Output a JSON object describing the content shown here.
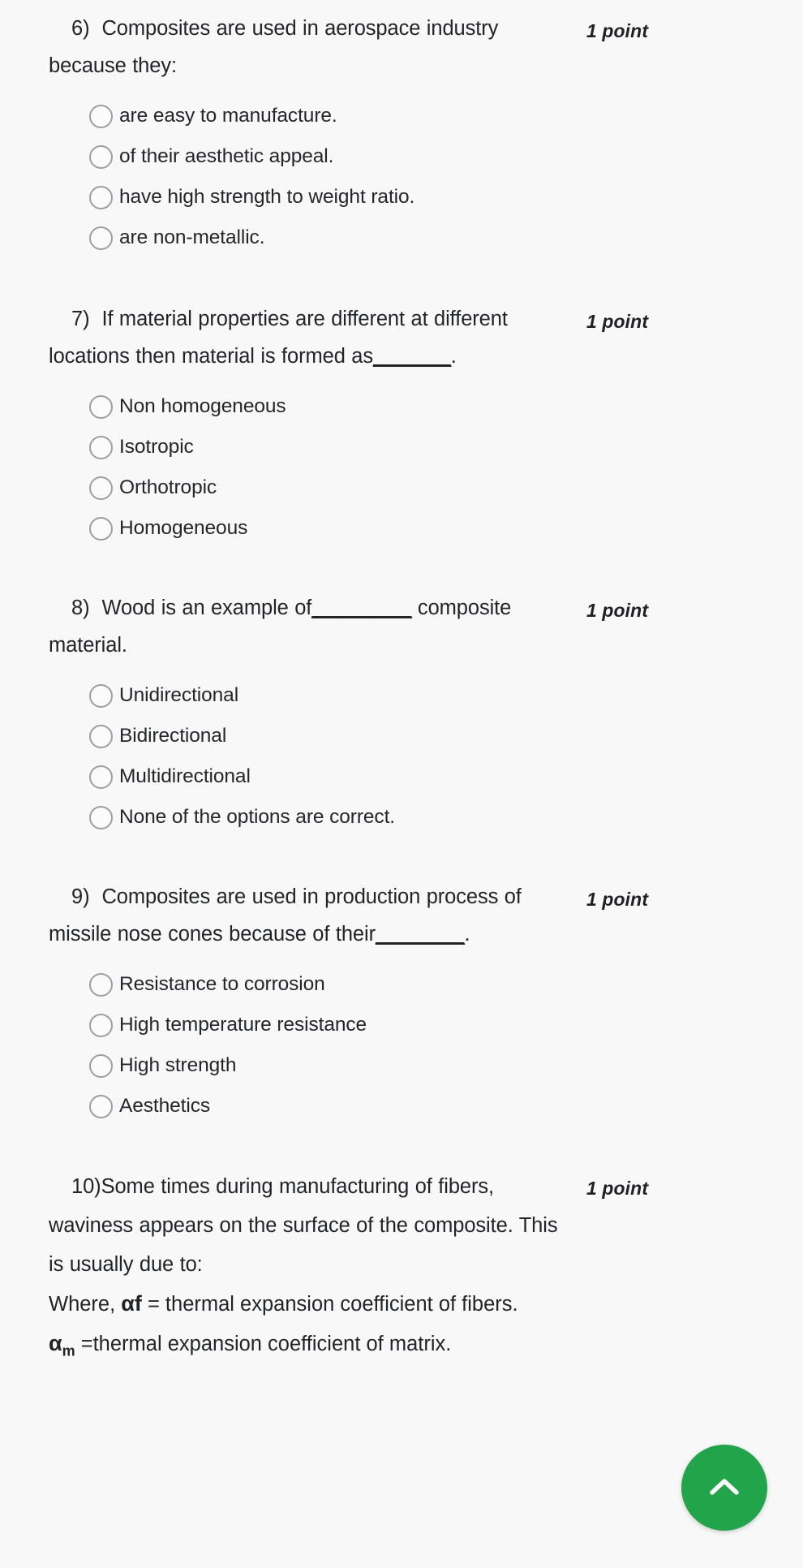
{
  "theme": {
    "background": "#f8f8f8",
    "text_color": "#202124",
    "radio_border": "#9b9fa4",
    "fab_color": "#22a44a"
  },
  "questions": [
    {
      "number": "6)",
      "text": "Composites are used in aerospace industry because they:",
      "points": "1 point",
      "options": [
        "are easy to manufacture.",
        "of their aesthetic appeal.",
        "have high strength to weight ratio.",
        "are non-metallic."
      ]
    },
    {
      "number": "7)",
      "text_before": "If material properties are different at different locations then material is formed as",
      "blank": "_______",
      "text_after": ".",
      "points": "1 point",
      "options": [
        "Non homogeneous",
        "Isotropic",
        "Orthotropic",
        "Homogeneous"
      ]
    },
    {
      "number": "8)",
      "text_before": "Wood is an example of",
      "blank": "_________",
      "text_after": " composite material.",
      "points": "1 point",
      "options": [
        "Unidirectional",
        "Bidirectional",
        "Multidirectional",
        "None of the options are correct."
      ]
    },
    {
      "number": "9)",
      "text_before": "Composites are used in production process of missile nose cones because of their",
      "blank": "________",
      "text_after": ".",
      "points": "1 point",
      "options": [
        "Resistance to corrosion",
        "High temperature resistance",
        "High strength",
        "Aesthetics"
      ]
    },
    {
      "number": "10)",
      "text": "Some times during manufacturing of fibers, waviness appears on the surface of the composite. This is usually due to:",
      "points": "1 point",
      "note_line_1_prefix": "Where, ",
      "note_line_1_symbol": "αf",
      "note_line_1_suffix": " = thermal expansion coefficient of fibers.",
      "note_line_2_symbol": "α",
      "note_line_2_subscript": "m",
      "note_line_2_suffix": " =thermal expansion coefficient of matrix.",
      "options": []
    }
  ],
  "fab": {
    "icon": "chevron-up-icon",
    "label": "Scroll to top"
  }
}
